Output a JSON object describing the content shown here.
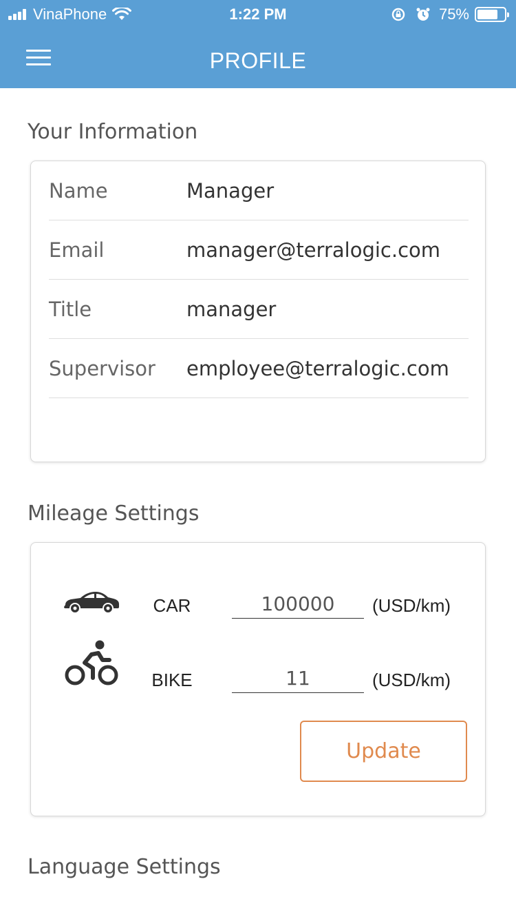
{
  "status_bar": {
    "carrier": "VinaPhone",
    "time": "1:22 PM",
    "battery_text": "75%",
    "battery_level": 0.75,
    "icons": [
      "signal-icon",
      "wifi-icon",
      "rotation-lock-icon",
      "alarm-icon",
      "battery-icon"
    ]
  },
  "header": {
    "title": "PROFILE",
    "menu_icon": "hamburger-menu-icon",
    "background": "#5a9fd5"
  },
  "your_information": {
    "title": "Your Information",
    "rows": [
      {
        "label": "Name",
        "value": "Manager"
      },
      {
        "label": "Email",
        "value": "manager@terralogic.com"
      },
      {
        "label": "Title",
        "value": "manager"
      },
      {
        "label": "Supervisor",
        "value": "employee@terralogic.com"
      }
    ]
  },
  "mileage_settings": {
    "title": "Mileage Settings",
    "vehicles": [
      {
        "icon": "car-icon",
        "label": "CAR",
        "value": "100000",
        "unit": "(USD/km)"
      },
      {
        "icon": "bicycle-icon",
        "label": "BIKE",
        "value": "11",
        "unit": "(USD/km)"
      }
    ],
    "update_label": "Update",
    "accent_color": "#e08a4e"
  },
  "language_settings": {
    "title": "Language Settings"
  }
}
